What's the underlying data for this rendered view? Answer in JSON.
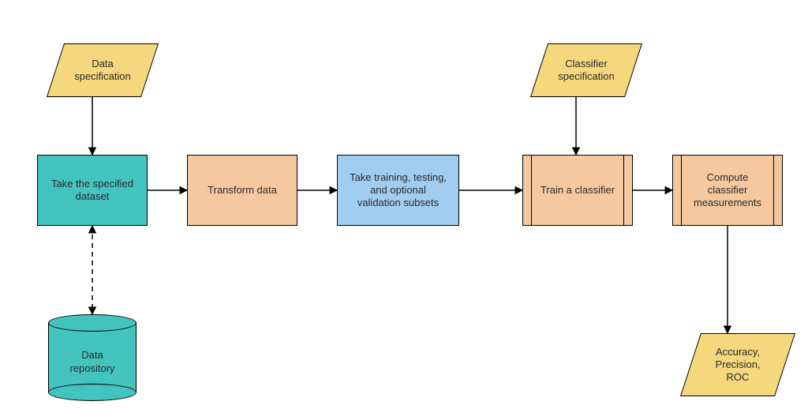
{
  "diagram": {
    "nodes": {
      "data_spec": {
        "label": "Data\nspecification",
        "shape": "parallelogram",
        "fill": "#f5d77e"
      },
      "classifier_spec": {
        "label": "Classifier\nspecification",
        "shape": "parallelogram",
        "fill": "#f5d77e"
      },
      "take_dataset": {
        "label": "Take the specified\ndataset",
        "shape": "process",
        "fill": "#43c4bf"
      },
      "transform": {
        "label": "Transform data",
        "shape": "process",
        "fill": "#f6c8a0"
      },
      "subsets": {
        "label": "Take training, testing,\nand optional\nvalidation subsets",
        "shape": "process",
        "fill": "#a2cdf2"
      },
      "train": {
        "label": "Train a classifier",
        "shape": "predefined",
        "fill": "#f6c8a0"
      },
      "compute": {
        "label": "Compute\nclassifier\nmeasurements",
        "shape": "predefined",
        "fill": "#f6c8a0"
      },
      "repo": {
        "label": "Data\nrepository",
        "shape": "cylinder",
        "fill": "#43c4bf"
      },
      "metrics": {
        "label": "Accuracy,\nPrecision,\nROC",
        "shape": "parallelogram",
        "fill": "#f5d77e"
      }
    },
    "edges": [
      {
        "from": "data_spec",
        "to": "take_dataset",
        "style": "solid"
      },
      {
        "from": "classifier_spec",
        "to": "train",
        "style": "solid"
      },
      {
        "from": "take_dataset",
        "to": "transform",
        "style": "solid"
      },
      {
        "from": "transform",
        "to": "subsets",
        "style": "solid"
      },
      {
        "from": "subsets",
        "to": "train",
        "style": "solid"
      },
      {
        "from": "train",
        "to": "compute",
        "style": "solid"
      },
      {
        "from": "compute",
        "to": "metrics",
        "style": "solid"
      },
      {
        "from": "take_dataset",
        "to": "repo",
        "style": "dashed",
        "bidirectional": true
      }
    ],
    "colors": {
      "yellow": "#f5d77e",
      "teal": "#43c4bf",
      "peach": "#f6c8a0",
      "blue": "#a2cdf2",
      "stroke": "#000000"
    }
  }
}
